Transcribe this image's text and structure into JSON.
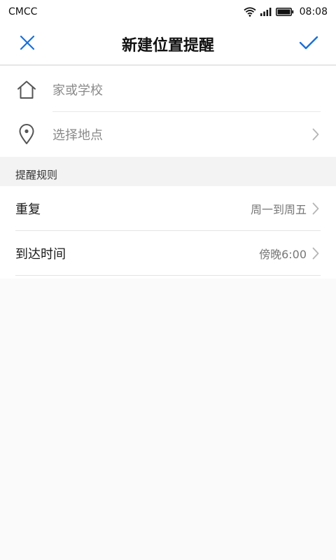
{
  "status_bar": {
    "carrier": "CMCC",
    "time": "08:08",
    "icons": [
      "wifi-icon",
      "signal-icon",
      "battery-icon"
    ]
  },
  "app_bar": {
    "title": "新建位置提醒",
    "close_icon": "close-icon",
    "confirm_icon": "check-icon",
    "accent_color": "#1a6fd9"
  },
  "location": {
    "home_school_label": "家或学校",
    "choose_place_label": "选择地点",
    "home_icon": "home-icon",
    "pin_icon": "location-pin-icon"
  },
  "rules": {
    "section_title": "提醒规则",
    "items": [
      {
        "label": "重复",
        "value": "周一到周五"
      },
      {
        "label": "到达时间",
        "value": "傍晚6:00"
      }
    ]
  }
}
